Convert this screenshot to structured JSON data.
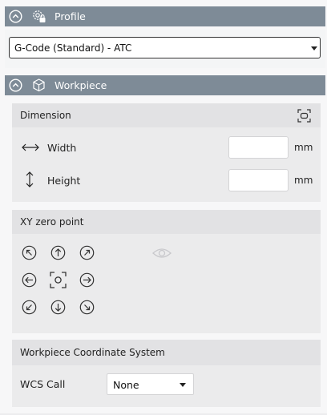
{
  "profile": {
    "title": "Profile",
    "selected": "G-Code (Standard) - ATC"
  },
  "workpiece": {
    "title": "Workpiece",
    "dimension": {
      "title": "Dimension",
      "width_label": "Width",
      "width_value": "",
      "width_unit": "mm",
      "height_label": "Height",
      "height_value": "",
      "height_unit": "mm"
    },
    "xy_zero": {
      "title": "XY zero point"
    },
    "wcs": {
      "title": "Workpiece Coordinate System",
      "call_label": "WCS Call",
      "call_value": "None"
    }
  },
  "icons": {
    "collapse": "chevron-up-circle-icon",
    "profile": "gear-lock-icon",
    "workpiece": "cube-icon",
    "dimension_fit": "fit-screen-icon",
    "width": "horizontal-arrows-icon",
    "height": "vertical-arrows-icon",
    "visibility": "eye-icon"
  }
}
